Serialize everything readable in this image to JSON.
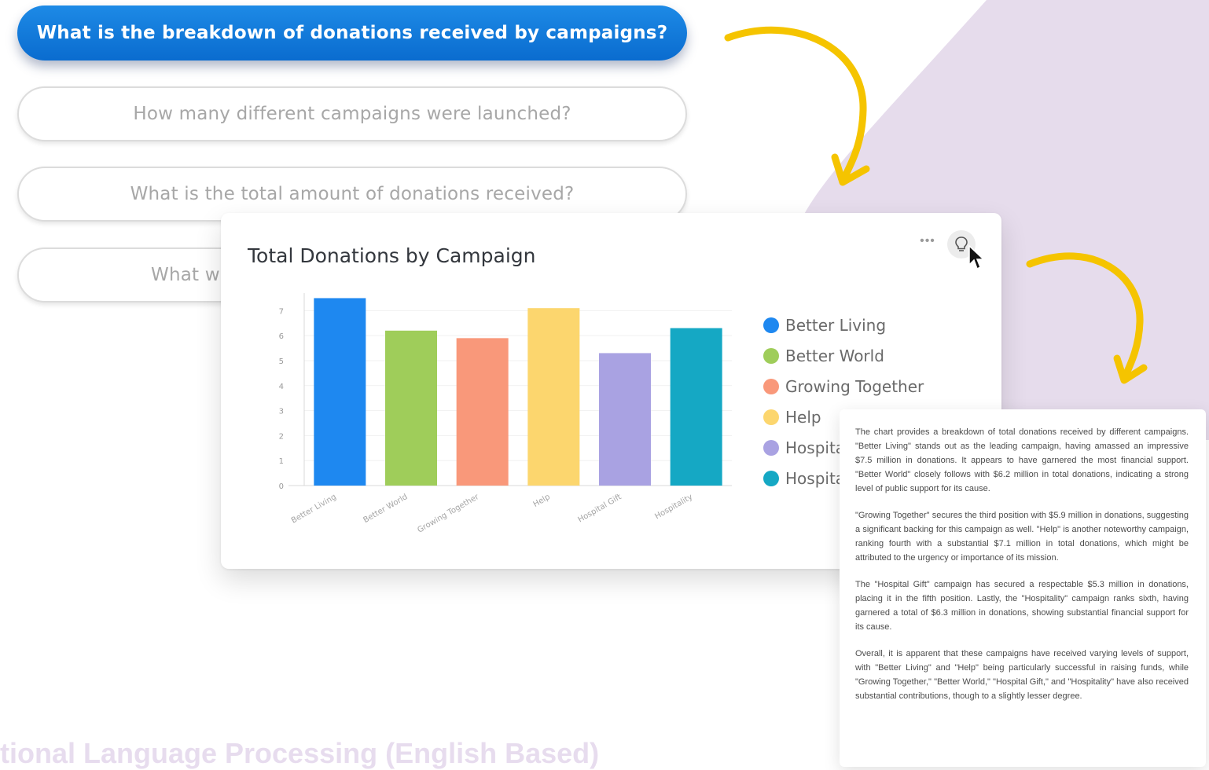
{
  "colors": {
    "accent_blue": "#1178d8",
    "lavender_background": "#e6dcec",
    "arrow_yellow": "#f5c400",
    "footer_text": "#e7dcee"
  },
  "questions": [
    {
      "label": "What is the breakdown of donations received by campaigns?",
      "active": true
    },
    {
      "label": "How many different campaigns were launched?",
      "active": false
    },
    {
      "label": "What is the total amount of donations received?",
      "active": false
    },
    {
      "label": "What wa",
      "active": false
    }
  ],
  "chart_card": {
    "title": "Total Donations by Campaign",
    "more_icon": "more-horizontal-icon",
    "insight_icon": "lightbulb-icon",
    "cursor_icon": "mouse-pointer-icon",
    "legend_visible_labels": [
      "Better Living",
      "Better World",
      "Growing Together",
      "Help",
      "Hospita",
      "Hospita"
    ]
  },
  "chart_data": {
    "type": "bar",
    "title": "Total Donations by Campaign",
    "categories": [
      "Better Living",
      "Better World",
      "Growing Together",
      "Help",
      "Hospital Gift",
      "Hospitality"
    ],
    "values": [
      7.5,
      6.2,
      5.9,
      7.1,
      5.3,
      6.3
    ],
    "colors": [
      "#1e88f0",
      "#9fcd5a",
      "#f9987a",
      "#fcd66e",
      "#a9a2e2",
      "#15a8c4"
    ],
    "yticks": [
      "0",
      "1",
      "2",
      "3",
      "4",
      "5",
      "6",
      "7"
    ],
    "ylim": [
      0,
      7.2
    ],
    "grid": true,
    "legend": "right"
  },
  "insight": {
    "paragraphs": [
      "The chart provides a breakdown of total donations received by different campaigns. \"Better Living\" stands out as the leading campaign, having amassed an impressive $7.5 million in donations. It appears to have garnered the most financial support. \"Better World\" closely follows with $6.2 million in total donations, indicating a strong level of public support for its cause.",
      "\"Growing Together\" secures the third position with $5.9 million in donations, suggesting a significant backing for this campaign as well. \"Help\" is another noteworthy campaign, ranking fourth with a substantial $7.1 million in total donations, which might be attributed to the urgency or importance of its mission.",
      "The \"Hospital Gift\" campaign has secured a respectable $5.3 million in donations, placing it in the fifth position. Lastly, the \"Hospitality\" campaign ranks sixth, having garnered a total of $6.3 million in donations, showing substantial financial support for its cause.",
      "Overall, it is apparent that these campaigns have received varying levels of support, with \"Better Living\" and \"Help\" being particularly successful in raising funds, while \"Growing Together,\" \"Better World,\" \"Hospital Gift,\" and \"Hospitality\" have also received substantial contributions, though to a slightly lesser degree."
    ]
  },
  "footer": {
    "heading_visible": "tional Language Processing (English Based)"
  }
}
